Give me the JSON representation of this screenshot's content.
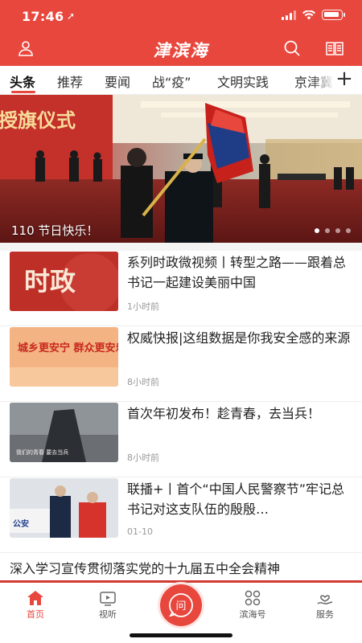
{
  "status_bar": {
    "time": "17:46",
    "location_glyph": "➚"
  },
  "header": {
    "app_title": "津滨海"
  },
  "colors": {
    "brand_red": "#e8473d",
    "muted_text": "#999999"
  },
  "channels": [
    "头条",
    "推荐",
    "要闻",
    "战“疫”",
    "文明实践",
    "京津冀"
  ],
  "channel_add": "+",
  "hero": {
    "caption": "110 节日快乐！",
    "banner_text": "授旗仪式",
    "slide_count": 4,
    "active_slide": 1
  },
  "feed": [
    {
      "title": "系列时政微视频丨转型之路——跟着总书记一起建设美丽中国",
      "time": "1小时前",
      "thumb_text": "时政"
    },
    {
      "title": "权威快报|这组数据是你我安全感的来源",
      "time": "8小时前",
      "thumb_text": "城乡更安宁 群众更安乐"
    },
    {
      "title": "首次年初发布！趁青春，去当兵！",
      "time": "8小时前",
      "thumb_text": "我们的青春 要去当兵"
    },
    {
      "title": "联播+丨首个“中国人民警察节”牢记总书记对这支队伍的殷殷…",
      "time": "01-10",
      "thumb_text": "公安"
    }
  ],
  "ticker_headline": "深入学习宣传贯彻落实党的十九届五中全会精神",
  "tabbar": {
    "items": [
      {
        "label": "首页",
        "icon": "home-icon"
      },
      {
        "label": "视听",
        "icon": "tv-icon"
      },
      {
        "label": "滨海号",
        "icon": "grid-icon"
      },
      {
        "label": "服务",
        "icon": "hand-heart-icon"
      }
    ],
    "center_glyph": "问",
    "center_icon": "ask-icon"
  }
}
